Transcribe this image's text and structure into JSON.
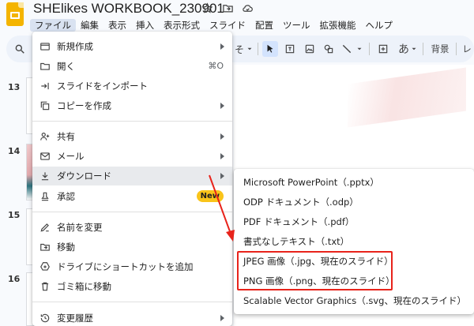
{
  "window": {
    "doc_title": "SHElikes WORKBOOK_230901"
  },
  "title_icons": [
    "star-icon",
    "move-to-folder-icon",
    "cloud-status-icon"
  ],
  "menubar": [
    "ファイル",
    "編集",
    "表示",
    "挿入",
    "表示形式",
    "スライド",
    "配置",
    "ツール",
    "拡張機能",
    "ヘルプ"
  ],
  "toolbar": {
    "partial_label": "そ",
    "ime_char": "あ",
    "background_label": "背景",
    "layout_partial": "レ"
  },
  "filmstrip": {
    "numbers": [
      "13",
      "14",
      "15",
      "16"
    ]
  },
  "file_menu": {
    "items": [
      {
        "icon": "slides-icon",
        "label": "新規作成",
        "submenu": true
      },
      {
        "icon": "folder-open-icon",
        "label": "開く",
        "shortcut": "⌘O"
      },
      {
        "icon": "import-icon",
        "label": "スライドをインポート"
      },
      {
        "icon": "copy-icon",
        "label": "コピーを作成",
        "submenu": true
      },
      {
        "icon": "share-icon",
        "label": "共有",
        "submenu": true
      },
      {
        "icon": "mail-icon",
        "label": "メール",
        "submenu": true
      },
      {
        "icon": "download-icon",
        "label": "ダウンロード",
        "submenu": true,
        "highlighted": true
      },
      {
        "icon": "approval-icon",
        "label": "承認",
        "badge": "New"
      },
      {
        "icon": "rename-icon",
        "label": "名前を変更"
      },
      {
        "icon": "move-icon",
        "label": "移動"
      },
      {
        "icon": "drive-shortcut-icon",
        "label": "ドライブにショートカットを追加"
      },
      {
        "icon": "trash-icon",
        "label": "ゴミ箱に移動"
      },
      {
        "icon": "history-icon",
        "label": "変更履歴",
        "submenu": true
      }
    ]
  },
  "download_submenu": {
    "items": [
      "Microsoft PowerPoint（.pptx）",
      "ODP ドキュメント（.odp）",
      "PDF ドキュメント（.pdf）",
      "書式なしテキスト（.txt）",
      "JPEG 画像（.jpg、現在のスライド）",
      "PNG 画像（.png、現在のスライド）",
      "Scalable Vector Graphics（.svg、現在のスライド）"
    ],
    "highlighted_items": [
      "JPEG 画像（.jpg、現在のスライド）",
      "PNG 画像（.png、現在のスライド）"
    ]
  },
  "colors": {
    "annotation_red": "#e8231b",
    "slides_yellow": "#f4b400",
    "badge_yellow": "#f9c41a"
  }
}
